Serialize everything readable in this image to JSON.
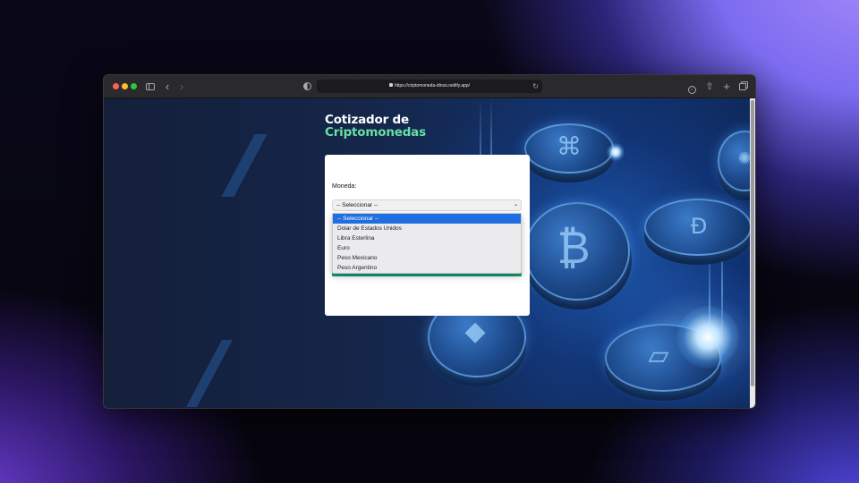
{
  "browser": {
    "url": "https://criptomoneda-dinos.netlify.app/"
  },
  "page": {
    "title_line1": "Cotizador de",
    "title_line2": "Criptomonedas",
    "accent_color": "#66e0a3"
  },
  "form": {
    "currency_label": "Moneda:",
    "select_value": "-- Seleccionar --",
    "options": [
      "-- Seleccionar --",
      "Dolar de Estados Unidos",
      "Libra Esterlina",
      "Euro",
      "Peso Mexicano",
      "Peso Argentino"
    ],
    "selected_index": 0,
    "button_color": "#12a17a"
  }
}
